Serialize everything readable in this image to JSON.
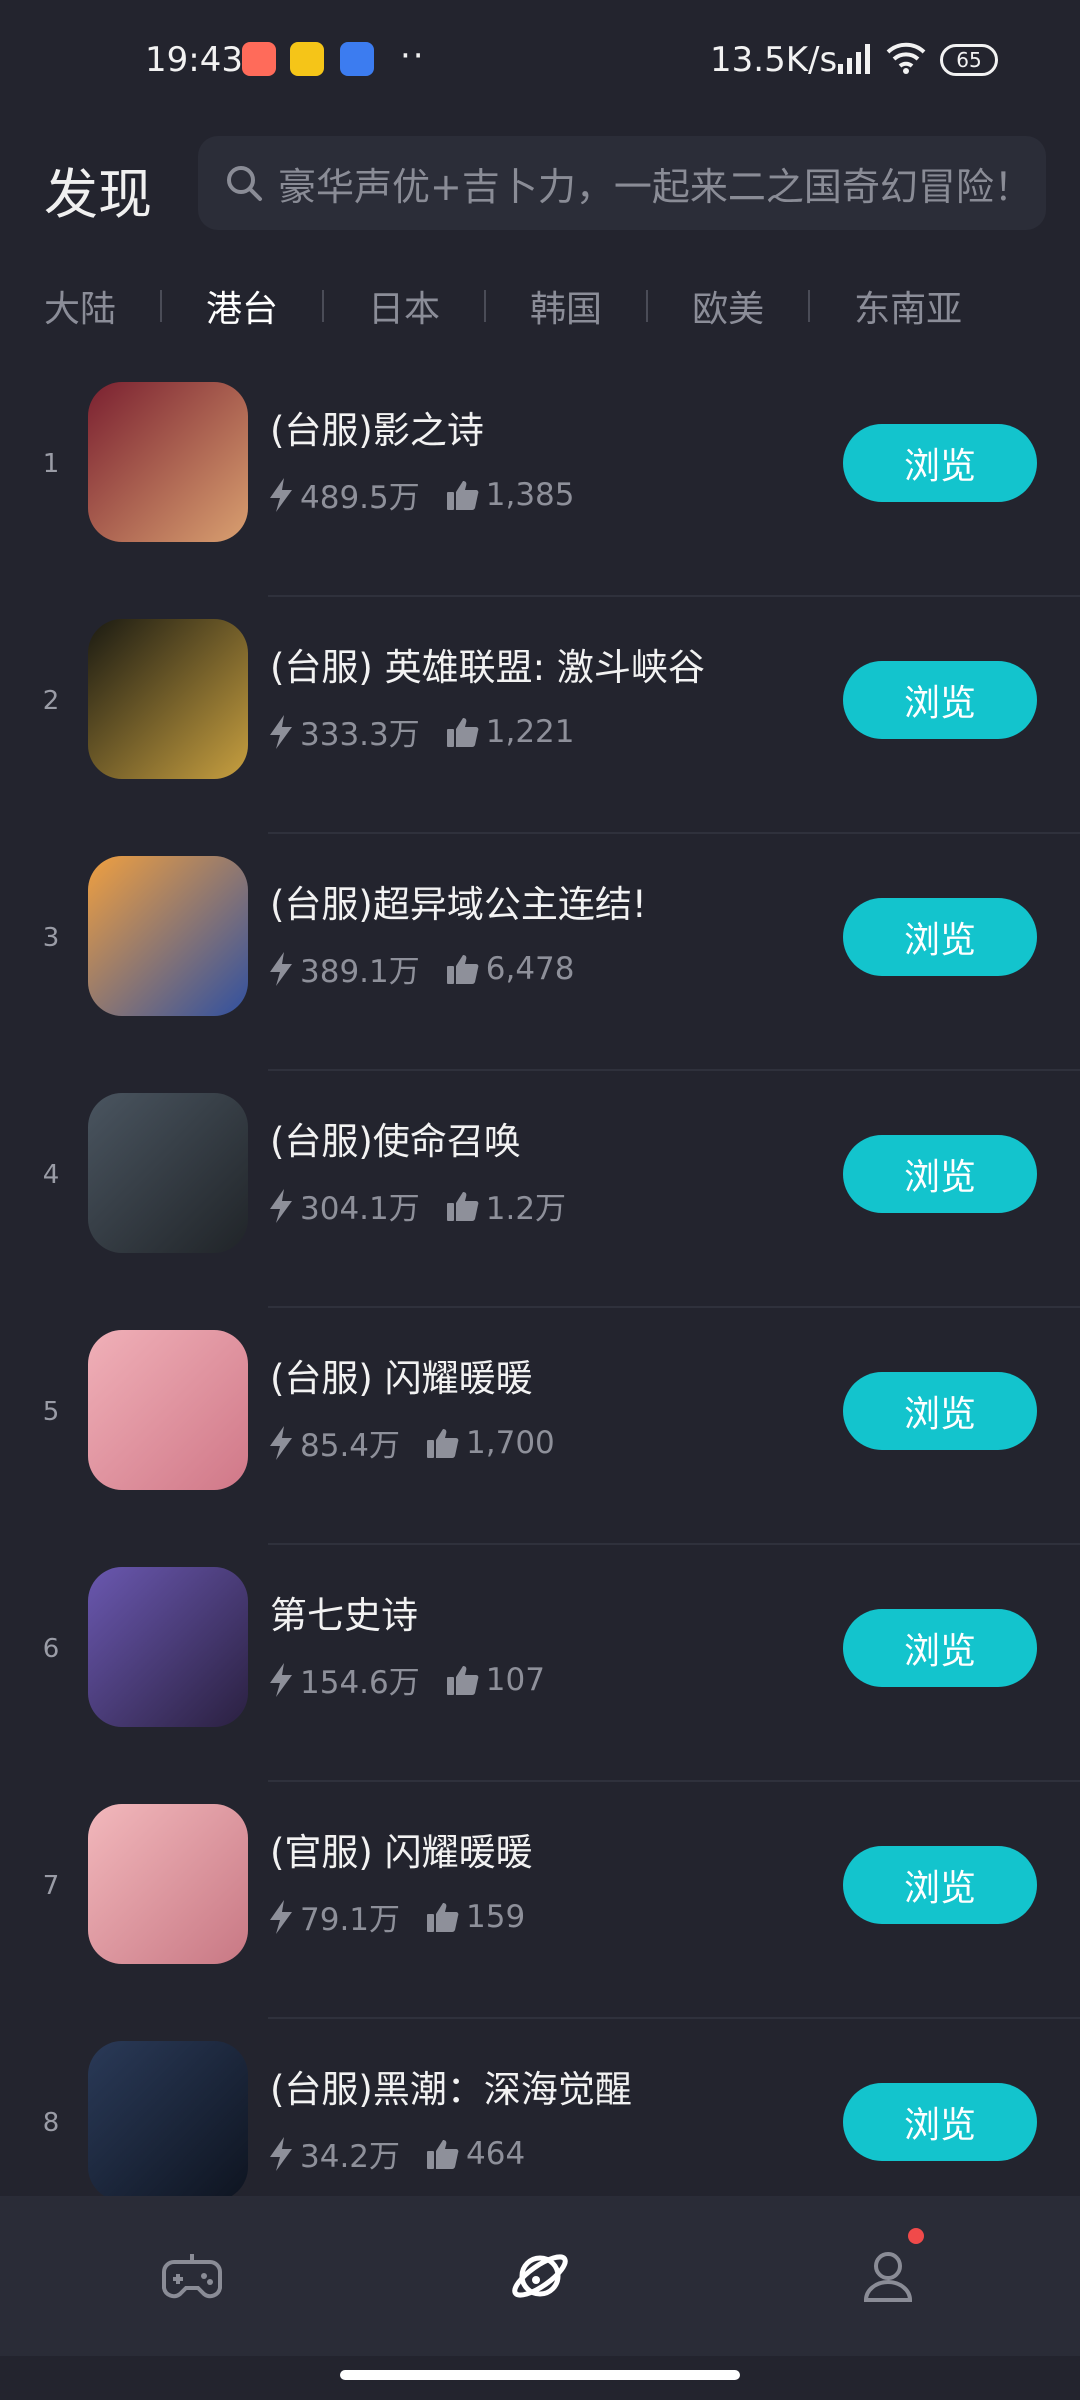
{
  "status_bar": {
    "time": "19:43",
    "net_speed": "13.5K/s",
    "battery": "65",
    "icons": [
      "app-notification-icon",
      "weather-app-icon",
      "app-icon",
      "more-dots-icon",
      "hd-signal-icon",
      "wifi-icon",
      "battery-icon"
    ]
  },
  "header": {
    "title": "发现",
    "search_placeholder": "豪华声优+吉卜力，一起来二之国奇幻冒险！"
  },
  "tabs": [
    {
      "label": "大陆",
      "active": false
    },
    {
      "label": "港台",
      "active": true
    },
    {
      "label": "日本",
      "active": false
    },
    {
      "label": "韩国",
      "active": false
    },
    {
      "label": "欧美",
      "active": false
    },
    {
      "label": "东南亚",
      "active": false
    }
  ],
  "games": [
    {
      "rank": "1",
      "name": "(台服)影之诗",
      "plays": "489.5万",
      "likes": "1,385",
      "button": "浏览",
      "icon_colors": [
        "#7a2030",
        "#d9a070"
      ]
    },
    {
      "rank": "2",
      "name": "(台服) 英雄联盟: 激斗峡谷",
      "plays": "333.3万",
      "likes": "1,221",
      "button": "浏览",
      "icon_colors": [
        "#1a1a12",
        "#c8a040"
      ]
    },
    {
      "rank": "3",
      "name": "(台服)超异域公主连结!",
      "plays": "389.1万",
      "likes": "6,478",
      "button": "浏览",
      "icon_colors": [
        "#f0a040",
        "#3050a0"
      ]
    },
    {
      "rank": "4",
      "name": "(台服)使命召唤",
      "plays": "304.1万",
      "likes": "1.2万",
      "button": "浏览",
      "icon_colors": [
        "#4a5560",
        "#202428"
      ]
    },
    {
      "rank": "5",
      "name": "(台服) 闪耀暖暖",
      "plays": "85.4万",
      "likes": "1,700",
      "button": "浏览",
      "icon_colors": [
        "#f0b0b8",
        "#d07888"
      ]
    },
    {
      "rank": "6",
      "name": "第七史诗",
      "plays": "154.6万",
      "likes": "107",
      "button": "浏览",
      "icon_colors": [
        "#6a58b0",
        "#2a2040"
      ]
    },
    {
      "rank": "7",
      "name": "(官服) 闪耀暖暖",
      "plays": "79.1万",
      "likes": "159",
      "button": "浏览",
      "icon_colors": [
        "#f2b8bc",
        "#c87884"
      ]
    },
    {
      "rank": "8",
      "name": "(台服)黑潮：深海觉醒",
      "plays": "34.2万",
      "likes": "464",
      "button": "浏览",
      "icon_colors": [
        "#2a3a58",
        "#0e1420"
      ]
    }
  ],
  "bottom_nav": [
    {
      "name": "nav-games",
      "icon": "gamepad-icon",
      "active": false
    },
    {
      "name": "nav-discover",
      "icon": "planet-icon",
      "active": true
    },
    {
      "name": "nav-profile",
      "icon": "user-icon",
      "active": false,
      "badge": true
    }
  ],
  "colors": {
    "accent": "#13c4cd",
    "background": "#23242e",
    "badge": "#f04a4a"
  }
}
